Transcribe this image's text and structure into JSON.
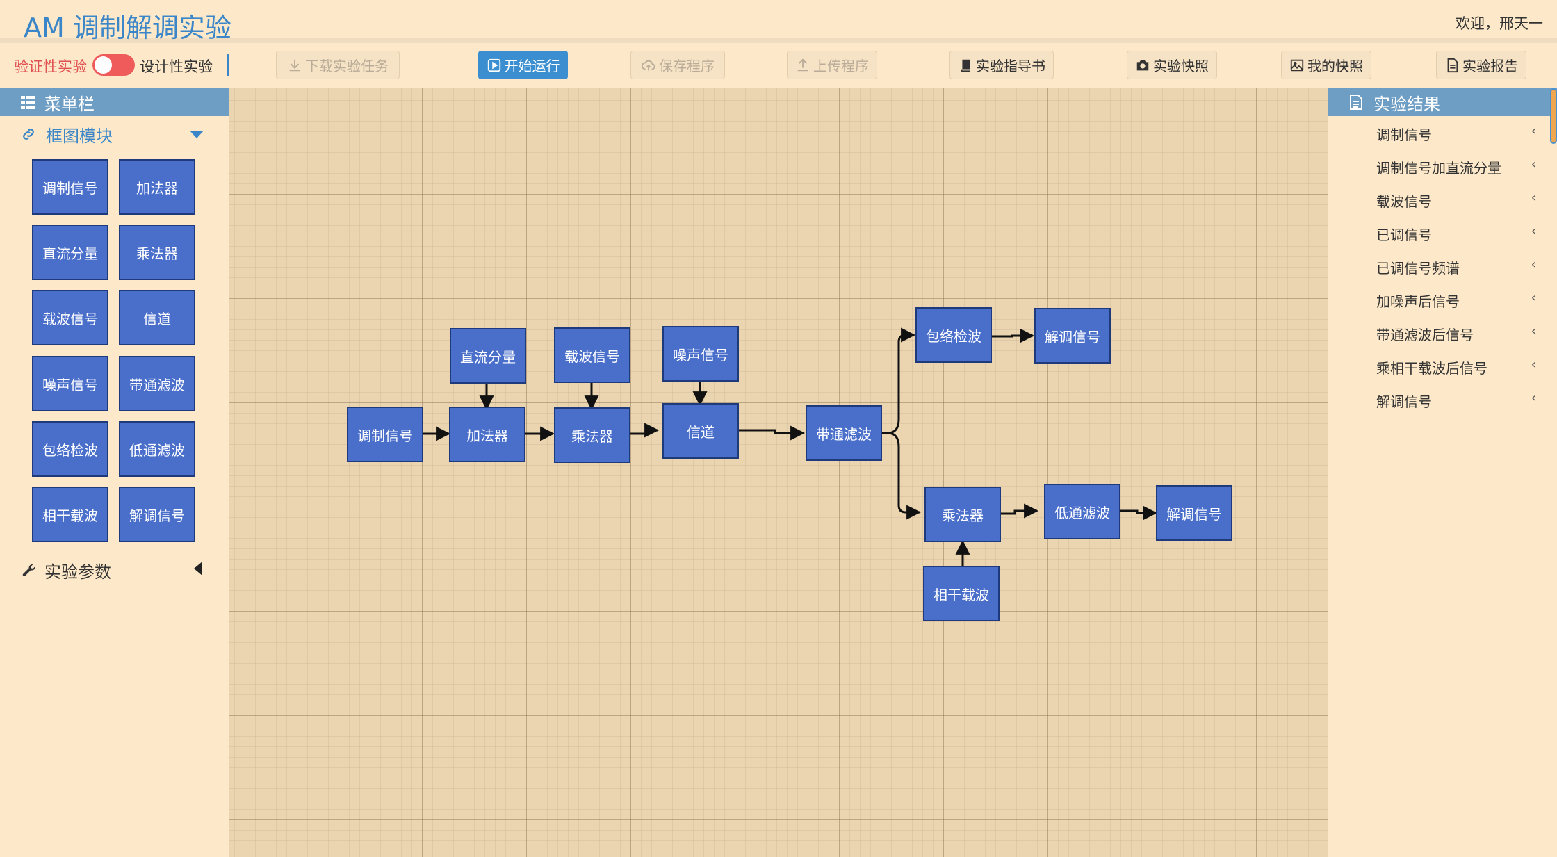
{
  "header": {
    "title": "AM 调制解调实验",
    "welcome": "欢迎，邢天一"
  },
  "toolbar": {
    "mode_verify": "验证性实验",
    "mode_design": "设计性实验",
    "buttons": [
      {
        "label": "下载实验任务",
        "icon": "download-icon",
        "state": "disabled"
      },
      {
        "label": "开始运行",
        "icon": "play-icon",
        "state": "primary"
      },
      {
        "label": "保存程序",
        "icon": "cloud-upload-icon",
        "state": "disabled"
      },
      {
        "label": "上传程序",
        "icon": "upload-icon",
        "state": "disabled"
      },
      {
        "label": "实验指导书",
        "icon": "book-icon",
        "state": "normal"
      },
      {
        "label": "实验快照",
        "icon": "camera-icon",
        "state": "normal"
      },
      {
        "label": "我的快照",
        "icon": "picture-icon",
        "state": "normal"
      },
      {
        "label": "实验报告",
        "icon": "report-icon",
        "state": "normal"
      }
    ]
  },
  "sidebar": {
    "title": "菜单栏",
    "block_section": "框图模块",
    "blocks": [
      "调制信号",
      "加法器",
      "直流分量",
      "乘法器",
      "载波信号",
      "信道",
      "噪声信号",
      "带通滤波",
      "包络检波",
      "低通滤波",
      "相干载波",
      "解调信号"
    ],
    "params_section": "实验参数"
  },
  "canvas": {
    "blocks": [
      "调制信号",
      "直流分量",
      "加法器",
      "载波信号",
      "乘法器",
      "噪声信号",
      "信道",
      "带通滤波",
      "包络检波",
      "解调信号",
      "乘法器",
      "相干载波",
      "低通滤波",
      "解调信号"
    ]
  },
  "results": {
    "title": "实验结果",
    "items": [
      "调制信号",
      "调制信号加直流分量",
      "载波信号",
      "已调信号",
      "已调信号频谱",
      "加噪声后信号",
      "带通滤波后信号",
      "乘相干载波后信号",
      "解调信号"
    ]
  },
  "colors": {
    "accent": "#3a86c8",
    "block": "#4a6fcb",
    "panel_header": "#6f9ec4",
    "toggle": "#ef5b5b",
    "background": "#fde9c9"
  }
}
